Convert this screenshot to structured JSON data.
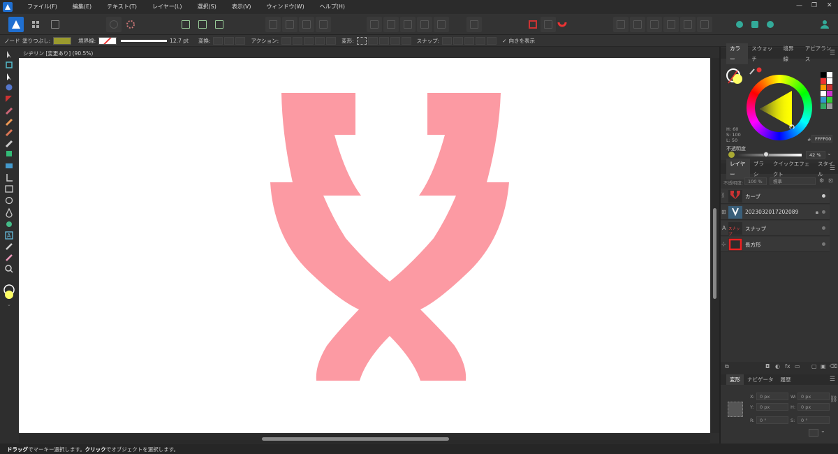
{
  "menubar": {
    "items": [
      "ファイル(F)",
      "編集(E)",
      "テキスト(T)",
      "レイヤー(L)",
      "選択(S)",
      "表示(V)",
      "ウィンドウ(W)",
      "ヘルプ(H)"
    ],
    "window_controls": [
      "—",
      "❐",
      "✕"
    ]
  },
  "context_toolbar": {
    "mode": "ノード",
    "fill_label": "塗りつぶし:",
    "fill_color": "#9a9a2e",
    "stroke_label": "境界線:",
    "stroke_width": "12.7 pt",
    "convert_label": "変換:",
    "action_label": "アクション:",
    "transform_label": "変形:",
    "snap_label": "スナップ:",
    "show_orientation_label": "向きを表示"
  },
  "document": {
    "tab_title": "シヂリン [変更あり] (90.5%)",
    "shape_color": "#fc9aa3"
  },
  "status": {
    "drag": "ドラッグ",
    "drag_text": "でマーキー選択します。",
    "click": "クリック",
    "click_text": "でオブジェクトを選択します。"
  },
  "color_panel": {
    "tabs": [
      "カラー",
      "スウォッチ",
      "境界線",
      "アピアランス"
    ],
    "h": "H: 60",
    "s": "S: 100",
    "l": "L: 50",
    "hex_label": "#:",
    "hex": "FFFF00",
    "opacity_label": "不透明度",
    "opacity_value": "42 %",
    "current_color": "#ffff66"
  },
  "layers_panel": {
    "tabs": [
      "レイヤー",
      "ブラシ",
      "クイックエフェクト",
      "スタイル"
    ],
    "opacity_label": "不透明度:",
    "opacity_value": "100 %",
    "blend_mode": "標準",
    "layers": [
      {
        "name": "カーブ",
        "type_icon": "curve-icon"
      },
      {
        "name": "2023032017202089",
        "type_icon": "image-icon"
      },
      {
        "name": "スナップ",
        "type_icon": "text-icon",
        "thumb_text": "スナップ"
      },
      {
        "name": "長方形",
        "type_icon": "rectangle-icon"
      }
    ]
  },
  "transform_panel": {
    "tabs": [
      "変形",
      "ナビゲータ",
      "履歴"
    ],
    "x_label": "X:",
    "x": "0 px",
    "y_label": "Y:",
    "y": "0 px",
    "w_label": "W:",
    "w": "0 px",
    "h_label": "H:",
    "h": "0 px",
    "r_label": "R:",
    "r": "0 °",
    "s_label": "S:",
    "s": "0 °"
  }
}
